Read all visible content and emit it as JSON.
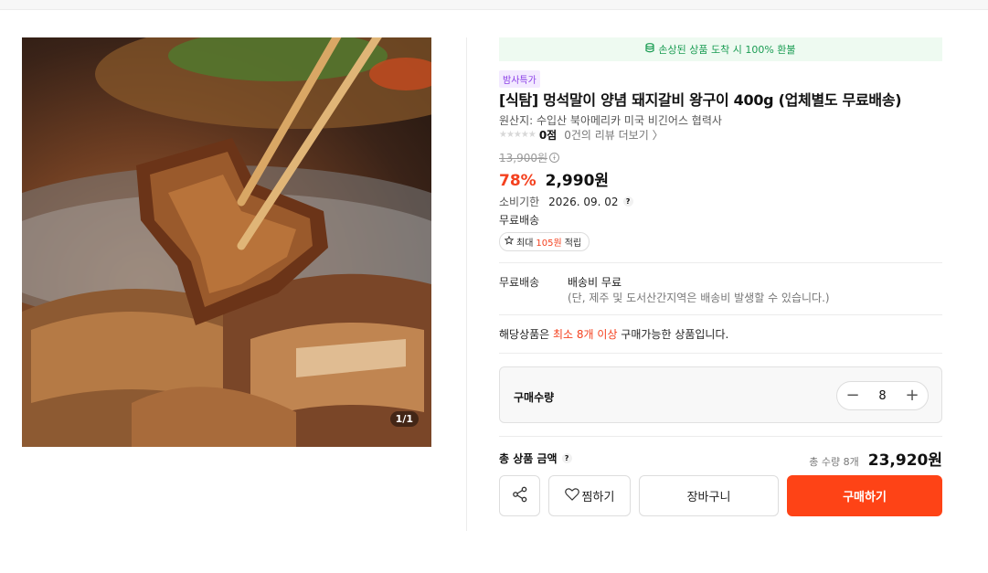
{
  "refund_notice": "손상된 상품 도착 시 100% 환불",
  "image_counter": "1/1",
  "badge": "밤사특가",
  "product": {
    "title": "[식탐] 멍석말이 양념 돼지갈비 왕구이 400g (업체별도 무료배송)",
    "origin": "원산지: 수입산 북아메리카 미국 비긴어스 협력사",
    "stars": "★★★★★",
    "score": "0점",
    "reviews_link": "0건의 리뷰 더보기 〉"
  },
  "price": {
    "original": "13,900원",
    "discount": "78%",
    "current": "2,990원",
    "accent_color": "#f4411f"
  },
  "expiry": {
    "label": "소비기한",
    "value": "2026. 09. 02"
  },
  "free_shipping_tag": "무료배송",
  "points": {
    "prefix": "최대 ",
    "amount": "105원",
    "suffix": " 적립"
  },
  "shipping": {
    "label": "무료배송",
    "value": "배송비 무료",
    "note": "(단, 제주 및 도서산간지역은 배송비 발생할 수 있습니다.)"
  },
  "minimum": {
    "prefix": "해당상품은 ",
    "highlight": "최소 8개 이상",
    "suffix": " 구매가능한 상품입니다."
  },
  "quantity": {
    "label": "구매수량",
    "value": "8",
    "minus": "−",
    "plus": "+"
  },
  "total": {
    "label": "총 상품 금액",
    "qty": "총 수량 8개",
    "amount": "23,920원"
  },
  "buttons": {
    "wish": "찜하기",
    "cart": "장바구니",
    "buy": "구매하기",
    "buy_color": "#fe4316"
  },
  "icons": {
    "refund": "money-stack-icon",
    "share": "share-icon",
    "heart": "heart-icon",
    "star": "star-outline-icon",
    "help": "question-icon",
    "info": "info-icon"
  }
}
